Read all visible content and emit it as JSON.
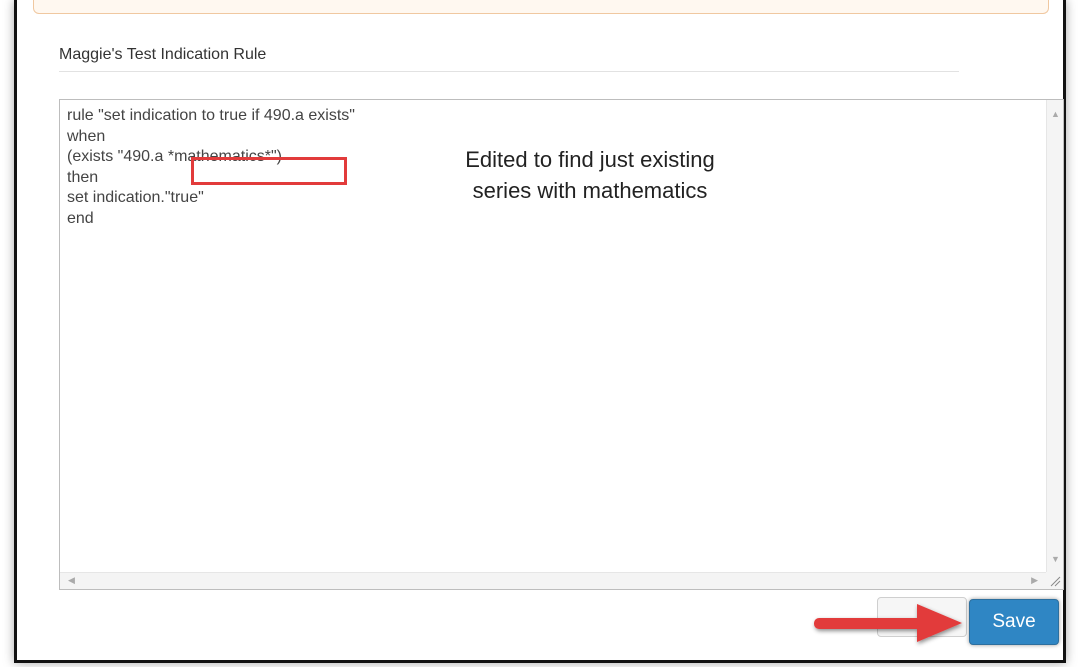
{
  "form": {
    "rule_title": "Maggie's Test Indication Rule"
  },
  "editor": {
    "lines": [
      "rule \"set indication to true if 490.a exists\"",
      "when",
      "(exists \"490.a *mathematics*\")",
      "then",
      "set indication.\"true\"",
      "end"
    ],
    "highlighted_text": "*mathematics*"
  },
  "annotation": {
    "line1": "Edited to find just existing",
    "line2": "series with mathematics"
  },
  "buttons": {
    "save_label": "Save",
    "cancel_label": ""
  },
  "colors": {
    "highlight": "#e23b3b",
    "arrow": "#e23b3b",
    "save_button": "#2f86c4"
  },
  "icons": {
    "arrow": "right-arrow-icon",
    "resize": "resize-grip-icon"
  }
}
